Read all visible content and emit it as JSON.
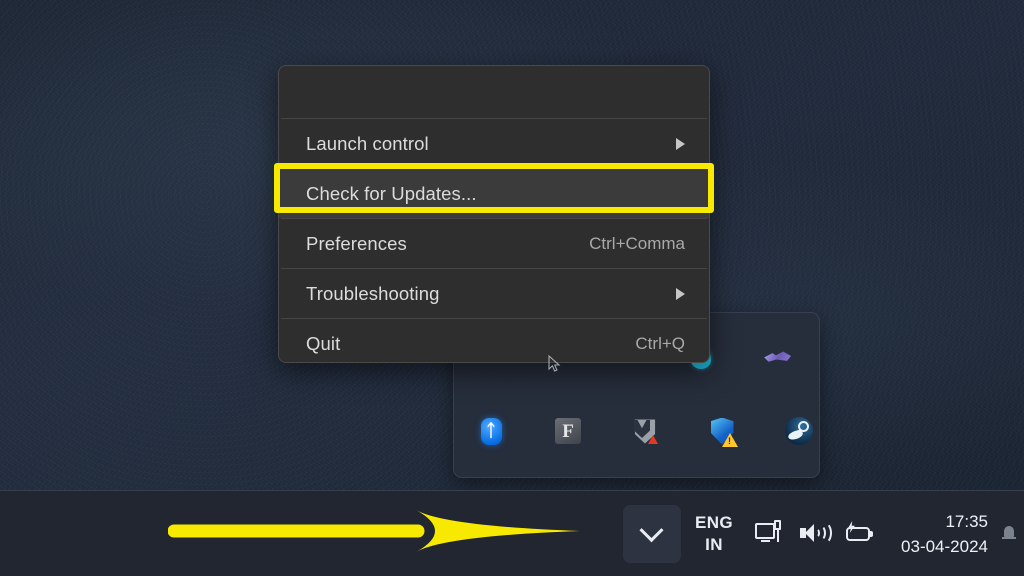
{
  "desktop": {
    "wallpaper_color": "#1e2836"
  },
  "context_menu": {
    "name": "tray-app-context-menu",
    "highlight_color": "#f7ea00",
    "background_color": "#2e2e2e",
    "items": [
      {
        "label": "Launch control",
        "shortcut": "",
        "has_submenu": true,
        "highlighted": false
      },
      {
        "label": "Check for Updates...",
        "shortcut": "",
        "has_submenu": false,
        "highlighted": true
      },
      {
        "label": "Preferences",
        "shortcut": "Ctrl+Comma",
        "has_submenu": false,
        "highlighted": false
      },
      {
        "label": "Troubleshooting",
        "shortcut": "",
        "has_submenu": true,
        "highlighted": false
      },
      {
        "label": "Quit",
        "shortcut": "Ctrl+Q",
        "has_submenu": false,
        "highlighted": false
      }
    ]
  },
  "tray_flyout": {
    "name": "hidden-icons-flyout",
    "top_row_icons": [
      {
        "icon": "water-drop-icon",
        "name": "drop-tray-icon"
      },
      {
        "icon": "purple-blob-icon",
        "name": "purple-tray-icon"
      }
    ],
    "bottom_row_icons": [
      {
        "icon": "bluetooth-icon",
        "name": "bluetooth-tray-icon"
      },
      {
        "icon": "fancontrol-f-icon",
        "name": "fancontrol-tray-icon"
      },
      {
        "icon": "malwarebytes-shield-icon",
        "name": "malwarebytes-tray-icon"
      },
      {
        "icon": "windows-security-shield-warning-icon",
        "name": "windows-security-tray-icon"
      },
      {
        "icon": "steam-icon",
        "name": "steam-tray-icon"
      }
    ]
  },
  "taskbar": {
    "chevron_icon": "chevron-down-icon",
    "language": {
      "line1": "ENG",
      "line2": "IN"
    },
    "status_icons": [
      {
        "icon": "network-monitor-icon",
        "name": "network-icon"
      },
      {
        "icon": "volume-icon",
        "name": "volume-icon"
      },
      {
        "icon": "battery-charging-icon",
        "name": "battery-icon"
      }
    ],
    "clock": {
      "time": "17:35",
      "date": "03-04-2024"
    },
    "notification_icon": "bell-icon"
  },
  "annotations": {
    "arrow": {
      "name": "yellow-pointer-arrow",
      "color": "#f7ea00",
      "points_to": "chevron-down-icon"
    },
    "highlight": {
      "name": "yellow-highlight-box",
      "color": "#f7ea00",
      "targets": "Check for Updates..."
    }
  }
}
